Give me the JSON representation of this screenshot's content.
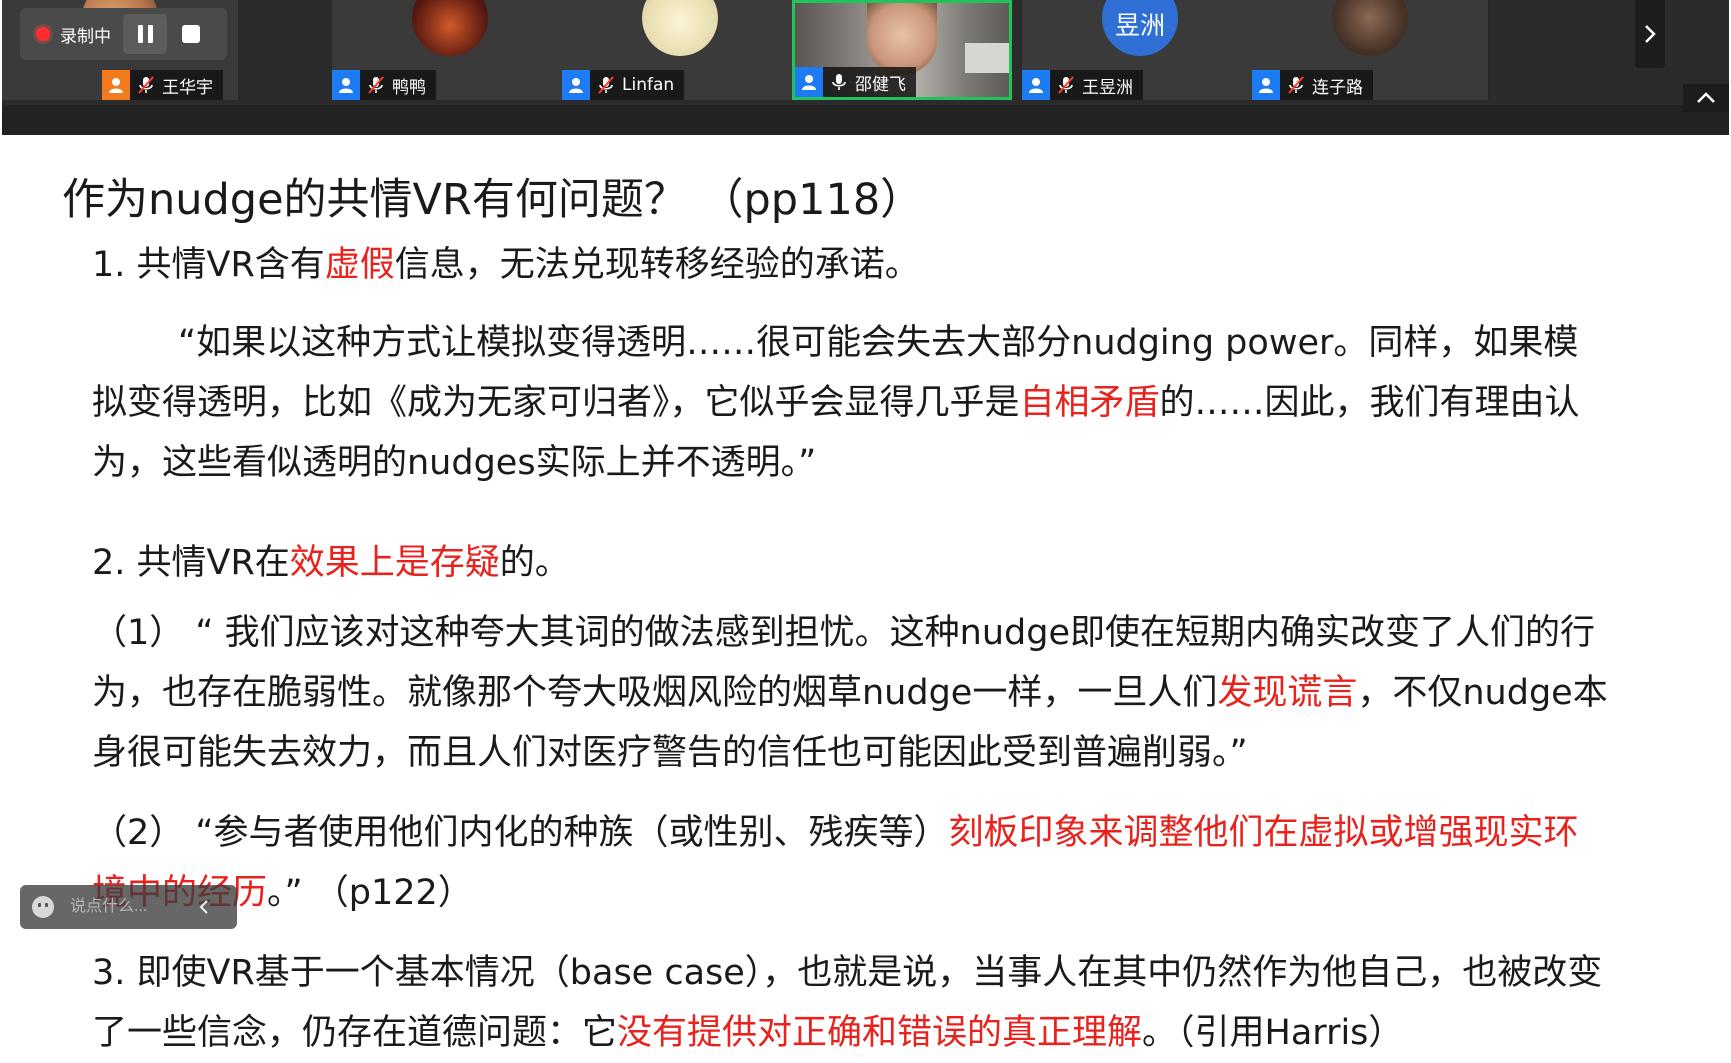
{
  "recording": {
    "status_label": "录制中",
    "pause_icon": "pause-icon",
    "stop_icon": "stop-icon"
  },
  "participants": [
    {
      "name": "王华宇",
      "role": "host",
      "mic": "muted",
      "avatar_icon": "avatar-photo"
    },
    {
      "name": "鸭鸭",
      "role": "attendee",
      "mic": "muted",
      "avatar_icon": "avatar-photo"
    },
    {
      "name": "Linfan",
      "role": "attendee",
      "mic": "muted",
      "avatar_icon": "avatar-cartoon"
    },
    {
      "name": "邵健飞",
      "role": "attendee",
      "mic": "on",
      "speaking": true,
      "avatar_icon": "camera-video"
    },
    {
      "name": "王昱洲",
      "role": "attendee",
      "mic": "muted",
      "avatar_text": "昱洲",
      "avatar_color": "#2f6fd6"
    },
    {
      "name": "连子路",
      "role": "attendee",
      "mic": "muted",
      "avatar_icon": "avatar-photo"
    }
  ],
  "toolbar": {
    "next_icon": "chevron-right-icon",
    "collapse_icon": "chevron-up-icon"
  },
  "slide": {
    "title": "作为nudge的共情VR有何问题？ （pp118）",
    "p1_a": "1. 共情VR含有",
    "p1_red": "虚假",
    "p1_b": "信息，无法兑现转移经验的承诺。",
    "p2_a": "“如果以这种方式让模拟变得透明……很可能会失去大部分nudging power。同样，如果模拟变得透明，比如《成为无家可归者》，它似乎会显得几乎是",
    "p2_red": "自相矛盾",
    "p2_b": "的……因此，我们有理由认为，这些看似透明的nudges实际上并不透明。”",
    "p3_a": "2. 共情VR在",
    "p3_red": "效果上是存疑",
    "p3_b": "的。",
    "p4_a": "（1） “ 我们应该对这种夸大其词的做法感到担忧。这种nudge即使在短期内确实改变了人们的行为，也存在脆弱性。就像那个夸大吸烟风险的烟草nudge一样，一旦人们",
    "p4_red": "发现谎言",
    "p4_b": "，不仅nudge本身很可能失去效力，而且人们对医疗警告的信任也可能因此受到普遍削弱。”",
    "p5_a": "（2） “参与者使用他们内化的种族（或性别、残疾等）",
    "p5_red": "刻板印象来调整他们在虚拟或增强现实环境中的经历",
    "p5_b": "。” （p122）",
    "p6_a": "3. 即使VR基于一个基本情况（base case），也就是说，当事人在其中仍然作为他自己，也被改变了一些信念，仍存在道德问题：它",
    "p6_red": "没有提供对正确和错误的真正理解",
    "p6_b": "。（引用Harris）",
    "highlight_color": "#e8231e"
  },
  "chat": {
    "placeholder": "说点什么...",
    "emoji_icon": "smile-icon",
    "collapse_icon": "chevron-left-icon"
  }
}
